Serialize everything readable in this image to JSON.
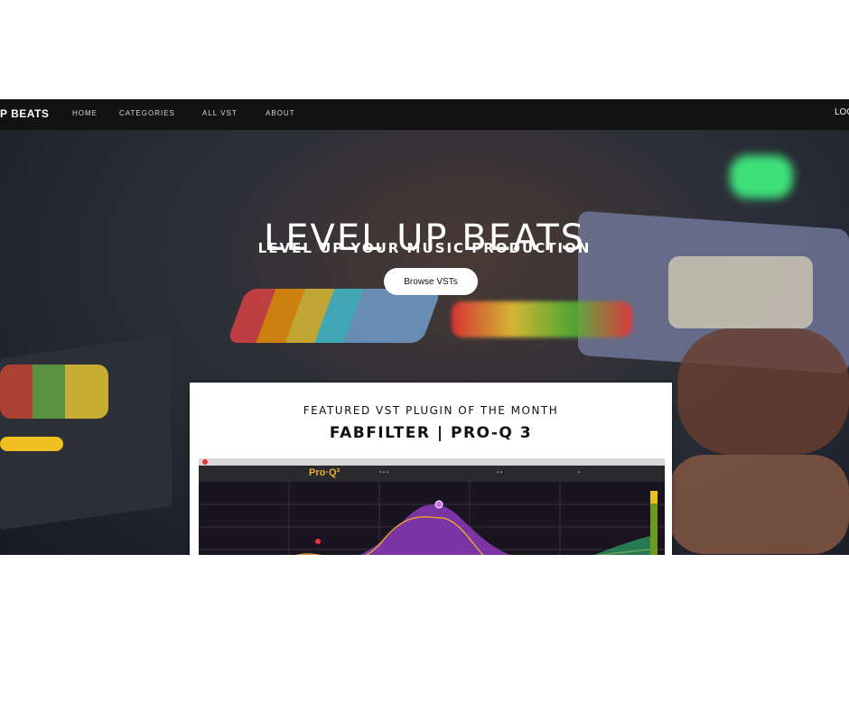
{
  "navbar": {
    "brand": "P BEATS",
    "items": [
      "HOME",
      "CATEGORIES",
      "ALL VST",
      "ABOUT"
    ],
    "login": "LOG"
  },
  "hero": {
    "title": "LEVEL UP BEATS",
    "subtitle": "LEVEL UP YOUR MUSIC PRODUCTION",
    "button_label": "Browse VSTs"
  },
  "featured": {
    "heading": "FEATURED VST PLUGIN OF THE MONTH",
    "name": "FABFILTER | PRO-Q 3",
    "plugin_logo": "Pro·Q³"
  },
  "colors": {
    "nav_bg": "#121212",
    "eq_purple": "#9b3fd0",
    "eq_orange": "#e8a030",
    "eq_green": "#2fa36a"
  }
}
